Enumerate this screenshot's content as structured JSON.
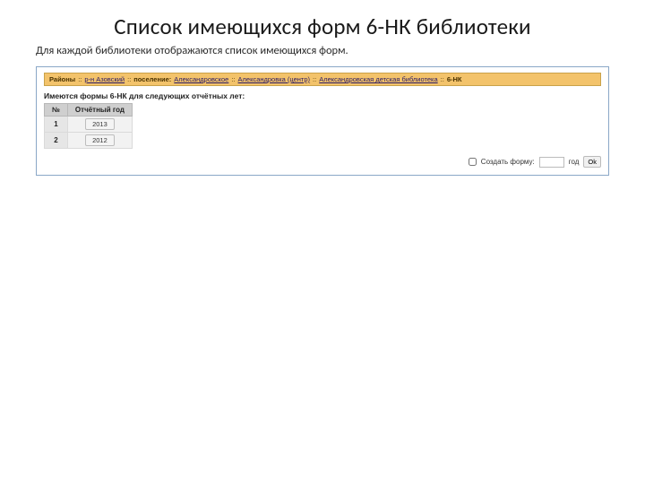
{
  "title": "Список имеющихся форм 6-НК библиотеки",
  "subtitle": "Для каждой библиотеки отображаются список имеющихся форм.",
  "breadcrumb": {
    "label0": "Районы",
    "sep": "::",
    "link1": "р-н Азовский",
    "label2": "поселение:",
    "link2": "Александровское",
    "link3": "Александровка (центр)",
    "link4": "Александровская детская библиотека",
    "tail": "6-НК"
  },
  "caption": "Имеются формы 6-НК для следующих отчётных лет:",
  "table": {
    "headers": {
      "num": "№",
      "year": "Отчётный год"
    },
    "rows": [
      {
        "num": "1",
        "year": "2013"
      },
      {
        "num": "2",
        "year": "2012"
      }
    ]
  },
  "create": {
    "label": "Создать форму:",
    "placeholder": "",
    "year_suffix": "год",
    "ok": "Ok"
  }
}
